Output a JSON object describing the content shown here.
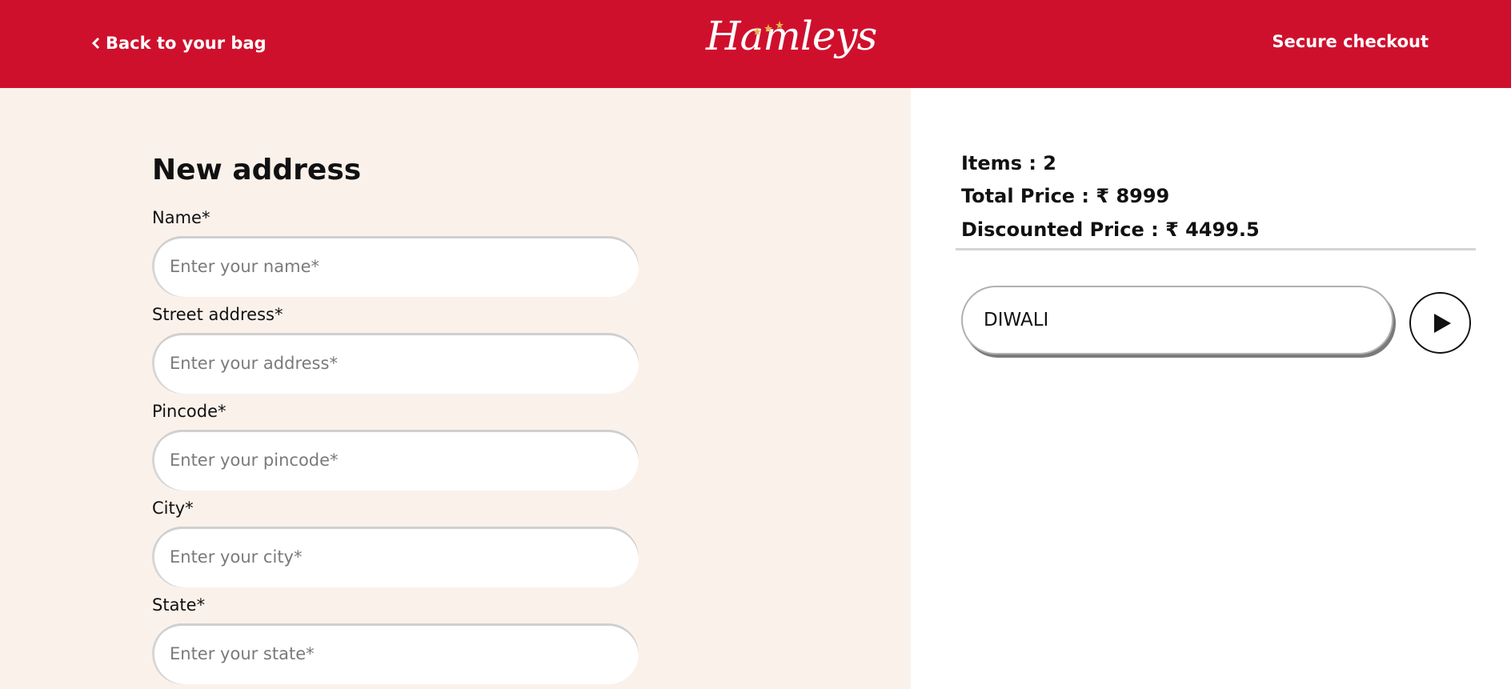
{
  "header": {
    "back_label": "Back to your bag",
    "brand": "Hamleys",
    "secure_label": "Secure checkout",
    "bg_color": "#cf102d"
  },
  "form": {
    "title": "New address",
    "fields": [
      {
        "label": "Name*",
        "placeholder": "Enter your name*",
        "value": ""
      },
      {
        "label": "Street address*",
        "placeholder": "Enter your address*",
        "value": ""
      },
      {
        "label": "Pincode*",
        "placeholder": "Enter your pincode*",
        "value": ""
      },
      {
        "label": "City*",
        "placeholder": "Enter your city*",
        "value": ""
      },
      {
        "label": "State*",
        "placeholder": "Enter your state*",
        "value": ""
      }
    ]
  },
  "summary": {
    "items": "Items : 2",
    "total": "Total Price : ₹ 8999",
    "discounted": "Discounted Price : ₹ 4499.5"
  },
  "coupon": {
    "value": "DIWALI",
    "apply_icon": "play-icon"
  }
}
